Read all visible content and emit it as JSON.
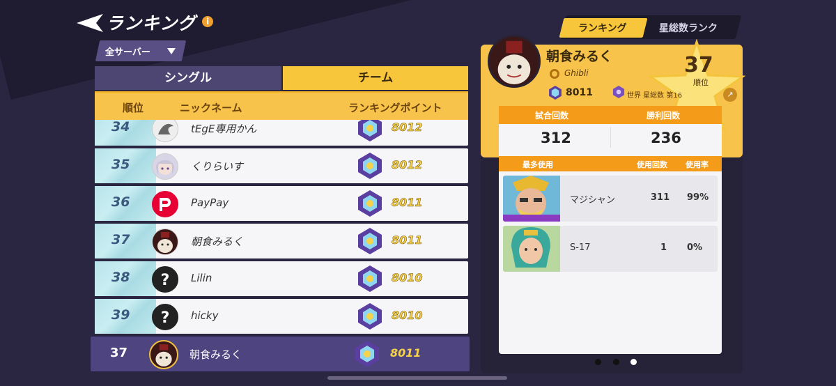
{
  "header": {
    "title": "ランキング",
    "info_glyph": "i",
    "server_filter": "全サーバー"
  },
  "tabs": [
    {
      "label": "シングル",
      "active": false
    },
    {
      "label": "チーム",
      "active": true
    }
  ],
  "columns": {
    "rank": "順位",
    "nickname": "ニックネーム",
    "points": "ランキングポイント"
  },
  "rows": [
    {
      "rank": "34",
      "name": "tEgE専用かん",
      "points": "8012",
      "avatar": "silhouette-icon"
    },
    {
      "rank": "35",
      "name": "くりらいす",
      "points": "8012",
      "avatar": "anime-girl-avatar"
    },
    {
      "rank": "36",
      "name": "PayPay",
      "points": "8011",
      "avatar": "paypay-logo"
    },
    {
      "rank": "37",
      "name": "朝食みるく",
      "points": "8011",
      "avatar": "cake-character-avatar"
    },
    {
      "rank": "38",
      "name": "Lilin",
      "points": "8010",
      "avatar": "question-mark-icon"
    },
    {
      "rank": "39",
      "name": "hicky",
      "points": "8010",
      "avatar": "question-mark-icon"
    }
  ],
  "self_row": {
    "rank": "37",
    "name": "朝食みるく",
    "points": "8011"
  },
  "right_tabs": [
    {
      "label": "ランキング",
      "active": true
    },
    {
      "label": "星総数ランク",
      "active": false
    }
  ],
  "profile": {
    "name": "朝食みるく",
    "guild": "Ghibli",
    "points": "8011",
    "world_label": "世界 星総数 第16",
    "rank": "37",
    "rank_label": "順位"
  },
  "stats": {
    "matches_label": "試合回数",
    "wins_label": "勝利回数",
    "matches": "312",
    "wins": "236"
  },
  "hero_table": {
    "most_used": "最多使用",
    "uses": "使用回数",
    "rate": "使用率",
    "heroes": [
      {
        "name": "マジシャン",
        "uses": "311",
        "rate": "99%"
      },
      {
        "name": "S-17",
        "uses": "1",
        "rate": "0%"
      }
    ]
  },
  "pager": {
    "count": 3,
    "active": 3
  },
  "colors": {
    "accent": "#f7c34a",
    "panel": "#4e4580",
    "orange": "#f49b1a",
    "background": "#2a2540"
  }
}
